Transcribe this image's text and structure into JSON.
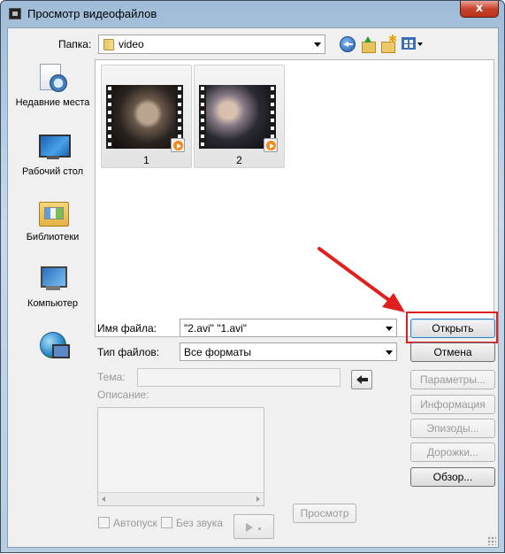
{
  "window": {
    "title": "Просмотр видеофайлов",
    "close_label": "x"
  },
  "lookin": {
    "label": "Папка:",
    "value": "video"
  },
  "places": [
    {
      "label": "Недавние места",
      "icon": "recent-places-icon"
    },
    {
      "label": "Рабочий стол",
      "icon": "desktop-icon"
    },
    {
      "label": "Библиотеки",
      "icon": "libraries-icon"
    },
    {
      "label": "Компьютер",
      "icon": "computer-icon"
    },
    {
      "label": "",
      "icon": "network-icon"
    }
  ],
  "files": [
    {
      "name": "1",
      "icon": "video-file-icon"
    },
    {
      "name": "2",
      "icon": "video-file-icon"
    }
  ],
  "filename": {
    "label": "Имя файла:",
    "value": "\"2.avi\" \"1.avi\""
  },
  "filetype": {
    "label": "Тип файлов:",
    "value": "Все форматы"
  },
  "buttons": {
    "open": "Открыть",
    "cancel": "Отмена",
    "parameters": "Параметры...",
    "info": "Информация",
    "episodes": "Эпизоды...",
    "tracks": "Дорожки...",
    "browse": "Обзор...",
    "preview": "Просмотр"
  },
  "meta": {
    "theme_label": "Тема:",
    "description_label": "Описание:"
  },
  "options": {
    "autoplay": "Автопуск",
    "mute": "Без звука"
  },
  "annotation": {
    "arrow_color": "#e01f1f",
    "highlight_color": "#e01f1f"
  }
}
